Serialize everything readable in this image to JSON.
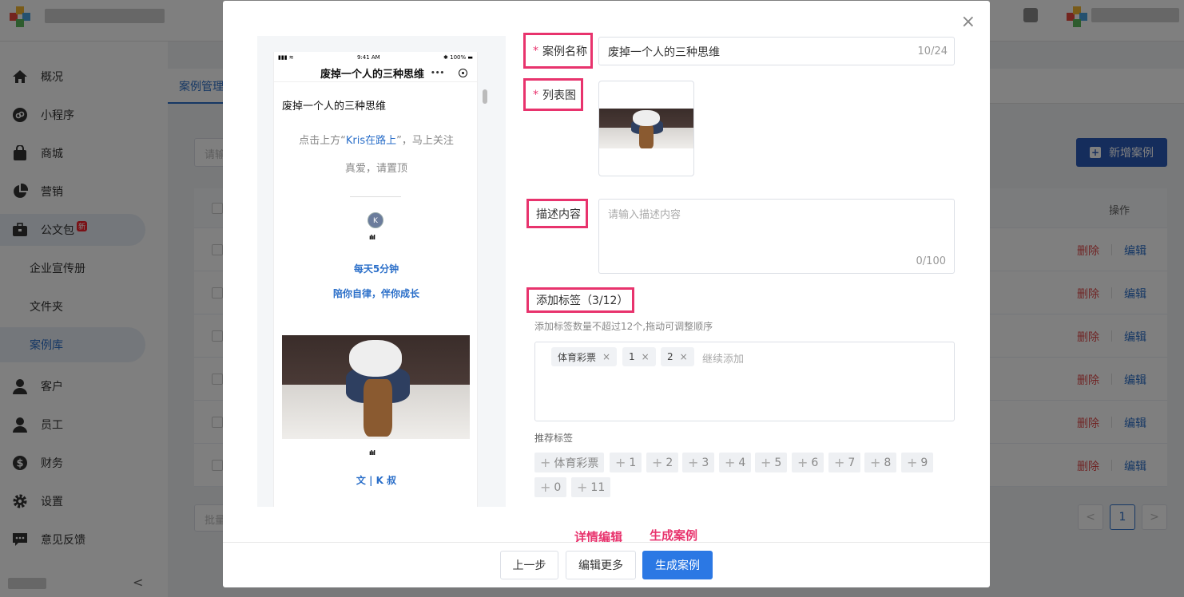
{
  "sidebar": {
    "items": [
      {
        "label": "概况",
        "icon": "home-icon"
      },
      {
        "label": "小程序",
        "icon": "mini-program-icon"
      },
      {
        "label": "商城",
        "icon": "shopping-bag-icon"
      },
      {
        "label": "营销",
        "icon": "pie-chart-icon"
      },
      {
        "label": "公文包",
        "icon": "briefcase-icon",
        "badge": "新"
      },
      {
        "label": "客户",
        "icon": "customer-icon"
      },
      {
        "label": "员工",
        "icon": "employee-icon"
      },
      {
        "label": "财务",
        "icon": "dollar-icon"
      },
      {
        "label": "设置",
        "icon": "gear-icon"
      },
      {
        "label": "意见反馈",
        "icon": "feedback-icon"
      }
    ],
    "subitems": [
      "企业宣传册",
      "文件夹",
      "案例库"
    ],
    "collapse": "<"
  },
  "main": {
    "tab": "案例管理",
    "search_placeholder": "请输",
    "add_button": "新增案例",
    "column_operation": "操作",
    "row_delete": "删除",
    "row_edit": "编辑",
    "batch_placeholder": "批量",
    "page_current": "1",
    "page_prev": "<",
    "page_next": ">"
  },
  "modal": {
    "close": "×",
    "preview": {
      "time": "9:41 AM",
      "battery": "100%",
      "nav_title": "废掉一个人的三种思维",
      "nav_more": "•••",
      "article_title": "废掉一个人的三种思维",
      "line1_prefix": "点击上方“",
      "line1_link": "Kris在路上",
      "line1_suffix": "”，马上关注",
      "line2": "真爱，请置顶",
      "avatar_letter": "K",
      "slogan1": "每天5分钟",
      "slogan2": "陪你自律，伴你成长",
      "author": "文 | K 叔"
    },
    "form": {
      "name_label": "案例名称",
      "name_value": "废掉一个人的三种思维",
      "name_counter": "10/24",
      "image_label": "列表图",
      "desc_label": "描述内容",
      "desc_placeholder": "请输入描述内容",
      "desc_counter": "0/100",
      "tags_label": "添加标签（3/12）",
      "tags_hint": "添加标签数量不超过12个,拖动可调整顺序",
      "tags": [
        "体育彩票",
        "1",
        "2"
      ],
      "tags_input_placeholder": "继续添加",
      "rec_title": "推荐标签",
      "rec_tags": [
        "体育彩票",
        "1",
        "2",
        "3",
        "4",
        "5",
        "6",
        "7",
        "8",
        "9",
        "0",
        "11"
      ],
      "required_mark": "*"
    },
    "annotations": {
      "detail_edit": "详情编辑",
      "generate": "生成案例"
    },
    "buttons": {
      "prev": "上一步",
      "edit_more": "编辑更多",
      "generate": "生成案例"
    }
  },
  "colors": {
    "accent": "#2b78e4",
    "annotation": "#e8336d",
    "danger": "#e04b4b"
  }
}
